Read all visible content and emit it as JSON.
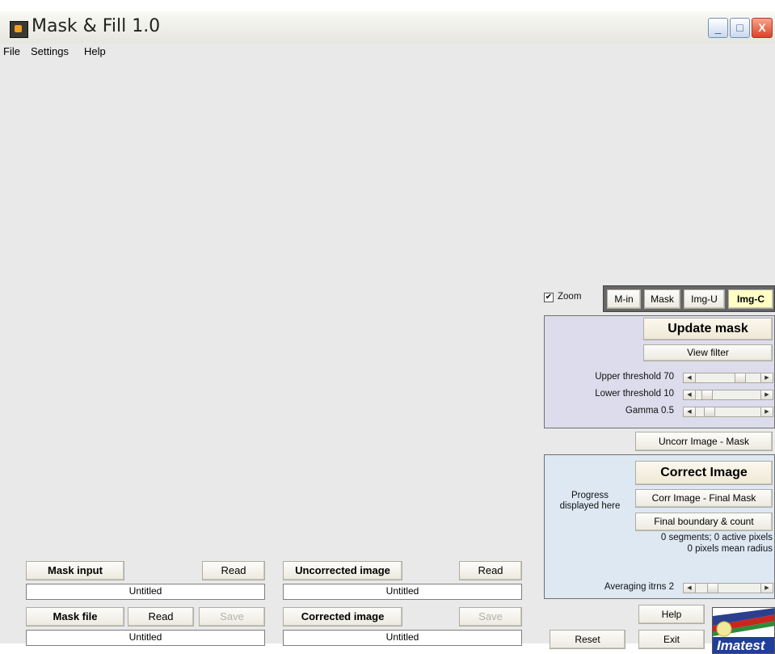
{
  "window": {
    "title": "Mask & Fill 1.0",
    "controls": {
      "minimize": "_",
      "maximize": "□",
      "close": "X"
    }
  },
  "menu": [
    "File",
    "Settings",
    "Help"
  ],
  "view": {
    "zoom_label": "Zoom",
    "zoom_checked": true,
    "check_mark": "✔",
    "buttons": [
      "M-in",
      "Mask",
      "Img-U",
      "Img-C"
    ],
    "active": "Img-C"
  },
  "mask_panel": {
    "update_mask": "Update mask",
    "view_filter": "View filter",
    "upper_threshold": "Upper threshold 70",
    "lower_threshold": "Lower threshold 10",
    "gamma": "Gamma 0.5",
    "upper_value": 70,
    "lower_value": 10,
    "gamma_value": 0.5
  },
  "uncorr_mask_button": "Uncorr Image - Mask",
  "correct_panel": {
    "correct_image": "Correct Image",
    "progress_line1": "Progress",
    "progress_line2": "displayed here",
    "corr_final_mask": "Corr Image - Final Mask",
    "final_boundary": "Final boundary & count",
    "segments_text": "0 segments;  0 active pixels",
    "radius_text": "0 pixels mean radius",
    "averaging": "Averaging itrns 2",
    "averaging_value": 2
  },
  "bottom": {
    "mask_input": "Mask input",
    "mask_input_read": "Read",
    "mask_input_file": "Untitled",
    "mask_file": "Mask file",
    "mask_file_read": "Read",
    "mask_file_save": "Save",
    "mask_file_name": "Untitled",
    "uncorrected_image": "Uncorrected image",
    "uncorrected_read": "Read",
    "uncorrected_file": "Untitled",
    "corrected_image": "Corrected image",
    "corrected_save": "Save",
    "corrected_file": "Untitled",
    "help": "Help",
    "reset": "Reset",
    "exit": "Exit"
  },
  "logo": {
    "text": "Imatest"
  },
  "colors": {
    "window_bg": "#e9e9ea",
    "mask_panel_bg": "#dcdcec",
    "correct_panel_bg": "#dde8f3",
    "active_button_bg": "#ffffc4",
    "logo_blue": "#1f3f9a"
  }
}
